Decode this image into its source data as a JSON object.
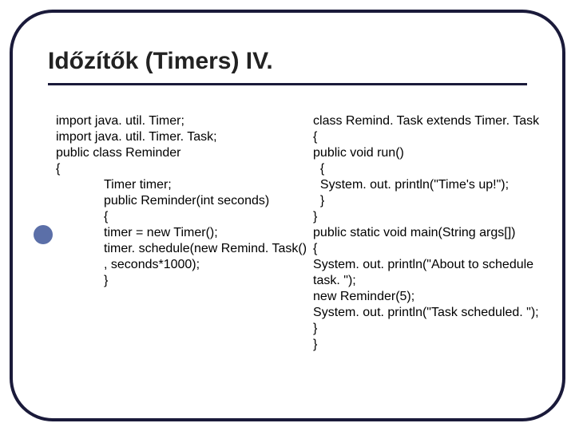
{
  "title": "Időzítők (Timers) IV.",
  "left": {
    "l1": "import java. util. Timer;",
    "l2": "import java. util. Timer. Task;",
    "l3": "public class Reminder",
    "l4": "{",
    "l5": "Timer timer;",
    "l6": "public Reminder(int seconds)",
    "l7": "{",
    "l8": "timer = new Timer();",
    "l9": "timer. schedule(new Remind. Task()",
    "l10": ", seconds*1000);",
    "l11": "}"
  },
  "right": {
    "r1": "class Remind. Task extends Timer. Task",
    "r2": "{",
    "r3": "public void run()",
    "r4": "  {",
    "r5": "  System. out. println(\"Time's up!\");",
    "r6": "  }",
    "r7": "}",
    "r8": "public static void main(String args[])",
    "r9": "{",
    "r10": "System. out. println(\"About to schedule",
    "r11": "task. \");",
    "r12": "new Reminder(5);",
    "r13": "System. out. println(\"Task scheduled. \");",
    "r14": "}",
    "r15": "}"
  }
}
